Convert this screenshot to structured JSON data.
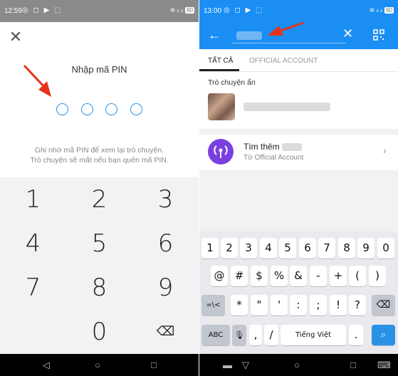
{
  "left": {
    "status": {
      "time": "12:59",
      "battery": "80"
    },
    "close_glyph": "✕",
    "pin_title": "Nhập mã PIN",
    "hint_line1": "Ghi nhớ mã PIN để xem lại trò chuyện.",
    "hint_line2": "Trò chuyện sẽ mất nếu bạn quên mã PIN.",
    "keys": [
      "1",
      "2",
      "3",
      "4",
      "5",
      "6",
      "7",
      "8",
      "9",
      "0"
    ],
    "backspace_glyph": "⌫",
    "nav": {
      "back": "◁",
      "home": "○",
      "recent": "□"
    }
  },
  "right": {
    "status": {
      "time": "13:00",
      "battery": "80"
    },
    "back_glyph": "←",
    "clear_glyph": "✕",
    "tabs": {
      "all": "TẤT CẢ",
      "official": "OFFICIAL ACCOUNT"
    },
    "section_label": "Trò chuyện ẩn",
    "find_more": "Tìm thêm",
    "official_account_sub": "Từ Official Account",
    "chevron": "›",
    "keyboard": {
      "row1": [
        "1",
        "2",
        "3",
        "4",
        "5",
        "6",
        "7",
        "8",
        "9",
        "0"
      ],
      "row2": [
        "@",
        "#",
        "$",
        "%",
        "&",
        "-",
        "+",
        "(",
        ")"
      ],
      "row3": [
        "=\\<",
        "*",
        "\"",
        "'",
        ":",
        ";",
        "!",
        "?"
      ],
      "abc": "ABC",
      "space": "Tiếng Việt",
      "comma": ",",
      "slash": "/",
      "period": "."
    },
    "nav": {
      "back": "▽",
      "home": "○",
      "recent": "□"
    }
  },
  "colors": {
    "accent": "#1a8ef3",
    "arrow": "#e8321c",
    "oa_icon": "#7a3fe0"
  }
}
